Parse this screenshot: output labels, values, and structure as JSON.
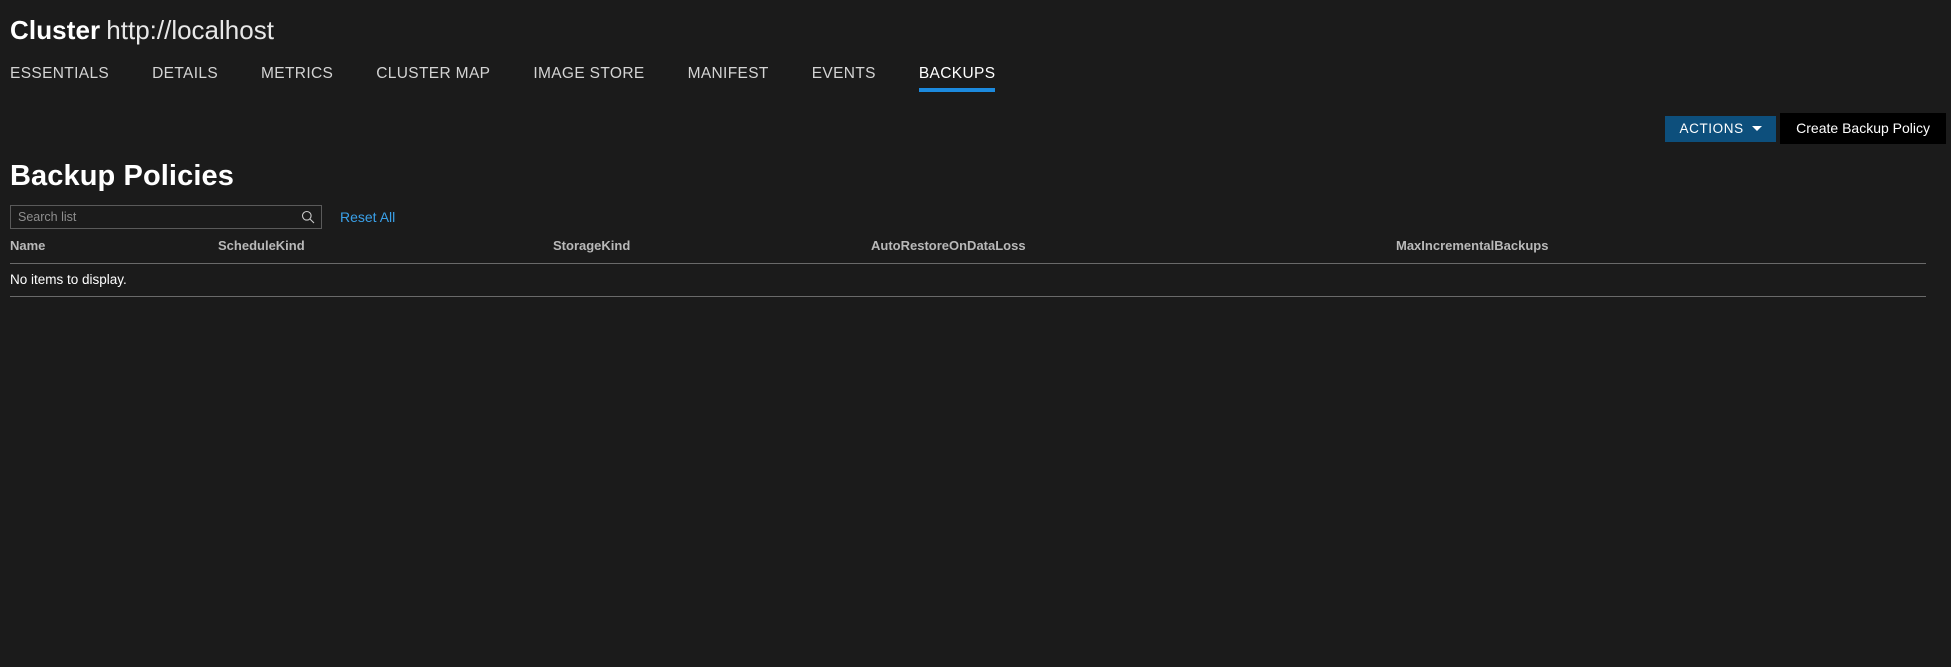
{
  "header": {
    "entity_label": "Cluster",
    "endpoint": "http://localhost"
  },
  "tabs": [
    {
      "id": "essentials",
      "label": "ESSENTIALS",
      "active": false
    },
    {
      "id": "details",
      "label": "DETAILS",
      "active": false
    },
    {
      "id": "metrics",
      "label": "METRICS",
      "active": false
    },
    {
      "id": "cluster-map",
      "label": "CLUSTER MAP",
      "active": false
    },
    {
      "id": "image-store",
      "label": "IMAGE STORE",
      "active": false
    },
    {
      "id": "manifest",
      "label": "MANIFEST",
      "active": false
    },
    {
      "id": "events",
      "label": "EVENTS",
      "active": false
    },
    {
      "id": "backups",
      "label": "BACKUPS",
      "active": true
    }
  ],
  "actions": {
    "button_label": "ACTIONS",
    "caret_icon": "chevron-down-icon",
    "menu_open": true,
    "menu_items": [
      {
        "id": "create-backup-policy",
        "label": "Create Backup Policy"
      }
    ]
  },
  "section": {
    "title": "Backup Policies"
  },
  "search": {
    "value": "",
    "placeholder": "Search list",
    "icon": "search-icon",
    "reset_label": "Reset All"
  },
  "table": {
    "columns": [
      {
        "id": "name",
        "label": "Name"
      },
      {
        "id": "schedule-kind",
        "label": "ScheduleKind"
      },
      {
        "id": "storage-kind",
        "label": "StorageKind"
      },
      {
        "id": "auto-restore-on-dataloss",
        "label": "AutoRestoreOnDataLoss"
      },
      {
        "id": "max-incremental-backups",
        "label": "MaxIncrementalBackups"
      }
    ],
    "rows": [],
    "empty_message": "No items to display."
  },
  "colors": {
    "background": "#1b1b1b",
    "accent_blue": "#1c8ade",
    "button_blue": "#0d4f7c",
    "link_blue": "#3aa0e8",
    "menu_background": "#000000",
    "rule": "#6a6a6a"
  }
}
